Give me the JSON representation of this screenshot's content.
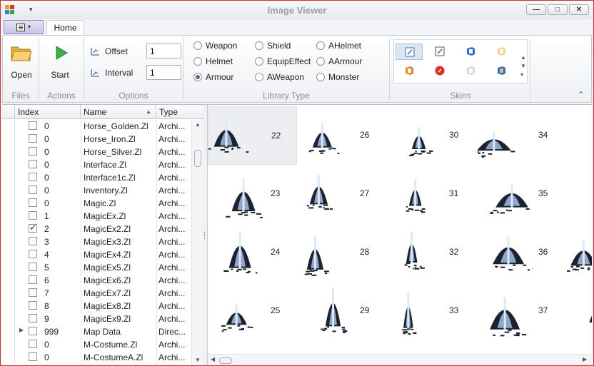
{
  "window": {
    "title": "Image Viewer",
    "controls": {
      "minimize": "—",
      "maximize": "□",
      "close": "✕"
    }
  },
  "qat_arrow": "▾",
  "tabs": {
    "home": "Home"
  },
  "ribbon": {
    "files_group": {
      "label": "Files",
      "open_label": "Open"
    },
    "actions_group": {
      "label": "Actions",
      "start_label": "Start"
    },
    "options_group": {
      "label": "Options",
      "offset_label": "Offset",
      "offset_value": "1",
      "interval_label": "Interval",
      "interval_value": "1"
    },
    "library_group": {
      "label": "Library Type",
      "options": [
        {
          "label": "Weapon",
          "checked": false
        },
        {
          "label": "Helmet",
          "checked": false
        },
        {
          "label": "Armour",
          "checked": true
        },
        {
          "label": "Shield",
          "checked": false
        },
        {
          "label": "EquipEffect",
          "checked": false
        },
        {
          "label": "AWeapon",
          "checked": false
        },
        {
          "label": "AHelmet",
          "checked": false
        },
        {
          "label": "AArmour",
          "checked": false
        },
        {
          "label": "Monster",
          "checked": false
        }
      ]
    },
    "skins_group": {
      "label": "Skins",
      "skins": [
        "skin-edit-icon",
        "skin-edit-gray-icon",
        "skin-office-icon",
        "skin-office-light-icon",
        "skin-office-orange-icon",
        "skin-red-circle-icon",
        "skin-ghost-icon",
        "skin-office-blue-icon"
      ]
    }
  },
  "grid": {
    "columns": {
      "index": "Index",
      "name": "Name",
      "type": "Type"
    },
    "sort_arrow": "▲",
    "rows": [
      {
        "index": "0",
        "name": "Horse_Golden.Zl",
        "type": "Archi...",
        "checked": false,
        "expandable": false
      },
      {
        "index": "0",
        "name": "Horse_Iron.Zl",
        "type": "Archi...",
        "checked": false,
        "expandable": false
      },
      {
        "index": "0",
        "name": "Horse_Silver.Zl",
        "type": "Archi...",
        "checked": false,
        "expandable": false
      },
      {
        "index": "0",
        "name": "Interface.Zl",
        "type": "Archi...",
        "checked": false,
        "expandable": false
      },
      {
        "index": "0",
        "name": "Interface1c.Zl",
        "type": "Archi...",
        "checked": false,
        "expandable": false
      },
      {
        "index": "0",
        "name": "Inventory.Zl",
        "type": "Archi...",
        "checked": false,
        "expandable": false
      },
      {
        "index": "0",
        "name": "Magic.Zl",
        "type": "Archi...",
        "checked": false,
        "expandable": false
      },
      {
        "index": "1",
        "name": "MagicEx.Zl",
        "type": "Archi...",
        "checked": false,
        "expandable": false
      },
      {
        "index": "2",
        "name": "MagicEx2.Zl",
        "type": "Archi...",
        "checked": true,
        "expandable": false
      },
      {
        "index": "3",
        "name": "MagicEx3.Zl",
        "type": "Archi...",
        "checked": false,
        "expandable": false
      },
      {
        "index": "4",
        "name": "MagicEx4.Zl",
        "type": "Archi...",
        "checked": false,
        "expandable": false
      },
      {
        "index": "5",
        "name": "MagicEx5.Zl",
        "type": "Archi...",
        "checked": false,
        "expandable": false
      },
      {
        "index": "6",
        "name": "MagicEx6.Zl",
        "type": "Archi...",
        "checked": false,
        "expandable": false
      },
      {
        "index": "7",
        "name": "MagicEx7.Zl",
        "type": "Archi...",
        "checked": false,
        "expandable": false
      },
      {
        "index": "8",
        "name": "MagicEx8.Zl",
        "type": "Archi...",
        "checked": false,
        "expandable": false
      },
      {
        "index": "9",
        "name": "MagicEx9.Zl",
        "type": "Archi...",
        "checked": false,
        "expandable": false
      },
      {
        "index": "999",
        "name": "Map Data",
        "type": "Direc...",
        "checked": false,
        "expandable": true
      },
      {
        "index": "0",
        "name": "M-Costume.Zl",
        "type": "Archi...",
        "checked": false,
        "expandable": false
      },
      {
        "index": "0",
        "name": "M-CostumeA.Zl",
        "type": "Archi...",
        "checked": false,
        "expandable": false
      }
    ]
  },
  "viewer": {
    "columns": [
      [
        "22",
        "23",
        "24",
        "25"
      ],
      [
        "26",
        "27",
        "28",
        "29"
      ],
      [
        "30",
        "31",
        "32",
        "33"
      ],
      [
        "34",
        "35",
        "36",
        "37"
      ]
    ],
    "selected": "22"
  },
  "colors": {
    "accent_border": "#c7312f",
    "selection": "#dbe6f5"
  }
}
